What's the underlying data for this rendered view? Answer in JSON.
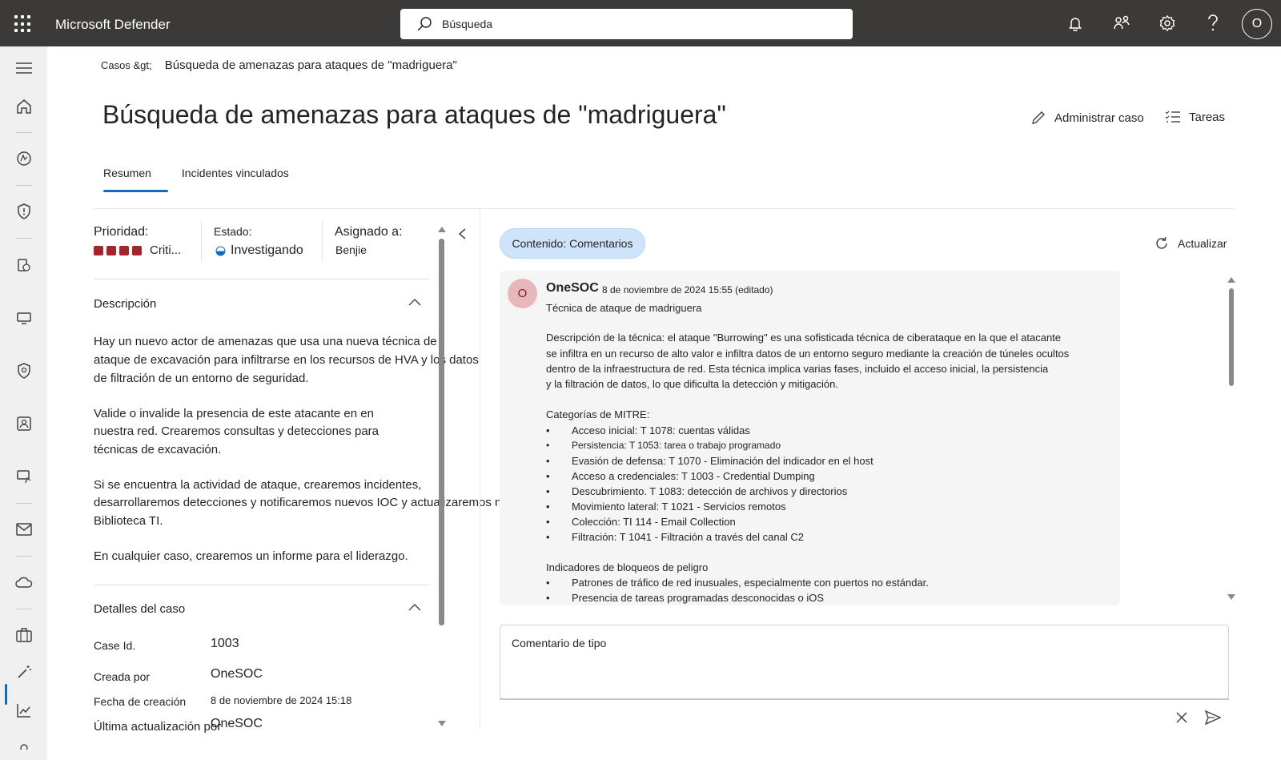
{
  "app": {
    "title": "Microsoft Defender"
  },
  "search": {
    "placeholder": "Búsqueda"
  },
  "topbar_icons": [
    "bell-icon",
    "share-icon",
    "gear-icon",
    "help-icon"
  ],
  "user": {
    "initial": "O"
  },
  "breadcrumb": {
    "root": "Casos &gt;",
    "current": "Búsqueda de amenazas para ataques de \"madriguera\""
  },
  "page": {
    "title": "Búsqueda de amenazas para ataques de \"madriguera\""
  },
  "actions": {
    "manage": "Administrar caso",
    "tasks": "Tareas"
  },
  "tabs": [
    {
      "label": "Resumen",
      "active": true
    },
    {
      "label": "Incidentes vinculados",
      "active": false
    }
  ],
  "meta": {
    "priority_label": "Prioridad:",
    "priority_value": "Criti...",
    "priority_color": "#a4262c",
    "status_label": "Estado:",
    "status_value": "Investigando",
    "assigned_label": "Asignado a:",
    "assigned_value": "Benjie"
  },
  "description": {
    "heading": "Descripción",
    "lines": [
      "Hay un nuevo actor de amenazas que usa una nueva técnica de",
      "ataque de excavación para infiltrarse en los recursos de HVA y los datos",
      "de filtración de un entorno de seguridad.",
      "Valide o invalide la presencia de este atacante en en",
      "nuestra red. Crearemos consultas y detecciones para",
      "técnicas de excavación.",
      "Si se encuentra la actividad de ataque, crearemos incidentes,",
      "desarrollaremos detecciones y notificaremos nuevos IOC y actualizaremos nuestro",
      "Biblioteca TI.",
      "En cualquier caso, crearemos un informe para el liderazgo."
    ]
  },
  "details": {
    "heading": "Detalles del caso",
    "rows": [
      {
        "label": "Case  Id.",
        "value": "1003"
      },
      {
        "label": "Creada por",
        "value": "OneSOC"
      },
      {
        "label": "Fecha de creación",
        "value": "8 de noviembre de 2024 15:18"
      },
      {
        "label": "Última actualización por",
        "value": "OneSOC"
      }
    ]
  },
  "comments_panel": {
    "filter": "Contenido: Comentarios",
    "refresh": "Actualizar",
    "comment": {
      "avatar": "O",
      "author": "OneSOC",
      "date": "8 de noviembre de 2024 15:55 (editado)",
      "subject": "Técnica de ataque de madriguera",
      "paragraph": [
        "Descripción de la técnica: el ataque \"Burrowing\" es una sofisticada técnica de ciberataque en la que el atacante",
        "se infiltra en un recurso de alto valor e infiltra datos de un entorno seguro mediante la creación de túneles ocultos",
        "dentro de la infraestructura de red. Esta técnica implica varias fases, incluido el acceso inicial, la persistencia",
        "y la filtración de datos, lo que dificulta la detección y mitigación."
      ],
      "mitre_heading": "Categorías de MITRE:",
      "mitre": [
        "Acceso inicial: T 1078: cuentas válidas",
        "Persistencia: T 1053: tarea o trabajo programado",
        "Evasión de defensa: T 1070 - Eliminación del indicador en el host",
        "Acceso a credenciales: T 1003 - Credential Dumping",
        "Descubrimiento. T 1083: detección de archivos y directorios",
        "Movimiento lateral: T 1021 - Servicios remotos",
        "Colección: TI 114 - Email Collection",
        "Filtración: T 1041 - Filtración a través del canal C2"
      ],
      "indicators_heading": "Indicadores de bloqueos de peligro",
      "indicators": [
        "Patrones de tráfico de red inusuales, especialmente con puertos no estándar.",
        "Presencia de tareas programadas desconocidas o iOS"
      ]
    },
    "compose_placeholder": "Comentario de tipo"
  }
}
